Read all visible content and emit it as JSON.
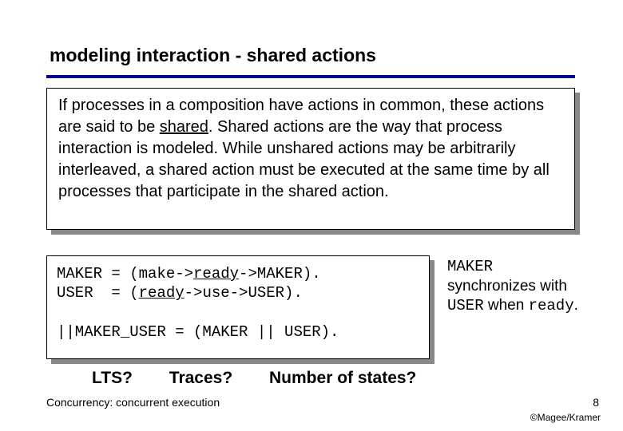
{
  "title": "modeling interaction - shared actions",
  "intro": {
    "p1a": "If processes in a composition have actions in common, these actions are said to be ",
    "shared_word": "shared",
    "p1b": ".  Shared actions are the way that process interaction is modeled. While unshared actions may be arbitrarily interleaved, a shared action must be executed at the same time by all processes that participate in the shared action."
  },
  "code": {
    "l1a": "MAKER = (make->",
    "l1b": "ready",
    "l1c": "->MAKER).",
    "l2a": "USER  = (",
    "l2b": "ready",
    "l2c": "->use->USER).",
    "blank": "",
    "l3": "||MAKER_USER = (MAKER || USER)."
  },
  "sidenote": {
    "a": "MAKER",
    "b": " synchronizes with ",
    "c": "USER",
    "d": " when ",
    "e": "ready",
    "f": "."
  },
  "questions": {
    "q1": "LTS?",
    "q2": "Traces?",
    "q3": "Number of states?"
  },
  "footer": {
    "left": "Concurrency: concurrent execution",
    "page": "8",
    "credit": "©Magee/Kramer"
  }
}
